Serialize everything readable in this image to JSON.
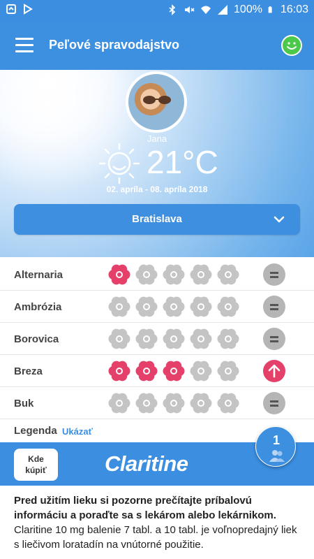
{
  "status_bar": {
    "battery": "100%",
    "time": "16:03",
    "left_icons": [
      "notification-icon",
      "play-store-icon"
    ],
    "right_icons": [
      "bluetooth-icon",
      "mute-icon",
      "wifi-icon",
      "signal-icon",
      "battery-icon"
    ]
  },
  "app_bar": {
    "title": "Peľové spravodajstvo",
    "menu_icon": "hamburger-icon",
    "action_icon": "smiley-icon"
  },
  "hero": {
    "user_name": "Jana",
    "temperature": "21°C",
    "weather_icon": "sun-icon",
    "date_range": "02. apríla - 08. apríla 2018",
    "city": "Bratislava"
  },
  "pollen": [
    {
      "name": "Alternaria",
      "level": 1,
      "max": 5,
      "trend": "equal"
    },
    {
      "name": "Ambrózia",
      "level": 0,
      "max": 5,
      "trend": "equal"
    },
    {
      "name": "Borovica",
      "level": 0,
      "max": 5,
      "trend": "equal"
    },
    {
      "name": "Breza",
      "level": 3,
      "max": 5,
      "trend": "up"
    },
    {
      "name": "Buk",
      "level": 0,
      "max": 5,
      "trend": "equal"
    }
  ],
  "legend": {
    "label": "Legenda",
    "link": "Ukázať"
  },
  "banner": {
    "buy_line1": "Kde",
    "buy_line2": "kúpiť",
    "brand": "Claritine"
  },
  "fab": {
    "count": "1"
  },
  "disclaimer": {
    "bold": "Pred užitím lieku si pozorne prečítajte príbalovú informáciu a poraďte sa s lekárom alebo lekárnikom.",
    "text": "Claritine 10 mg balenie 7 tabl. a 10 tabl. je voľnopredajný liek s liečivom loratadín na vnútorné použitie."
  },
  "colors": {
    "primary": "#3d8fe0",
    "flower_active": "#e5406a",
    "flower_inactive": "#c4c4c4",
    "trend_equal": "#b5b5b5",
    "trend_up": "#e5406a",
    "smiley": "#4cc84a"
  }
}
